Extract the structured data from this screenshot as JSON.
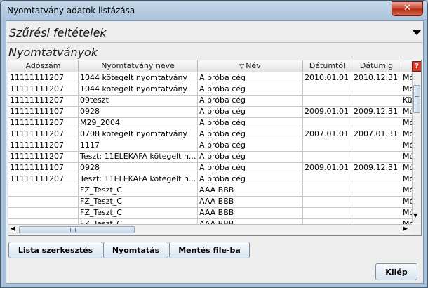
{
  "window": {
    "title": "Nyomtatvány adatok listázása",
    "close_glyph": "✕"
  },
  "filter": {
    "title": "Szűrési feltételek"
  },
  "section": {
    "title": "Nyomtatványok"
  },
  "table": {
    "columns": [
      "Adószám",
      "Nyomtatvány neve",
      "Név",
      "Dátumtól",
      "Dátumig",
      "?"
    ],
    "rows": [
      [
        "11111111207",
        "1044 kötegelt nyomtatvány",
        "A próba cég",
        "2010.01.01",
        "2010.12.31",
        "Mó"
      ],
      [
        "11111111207",
        "1044 kötegelt nyomtatvány",
        "A próba cég",
        "",
        "",
        "Mó"
      ],
      [
        "11111111207",
        "09teszt",
        "A próba cég",
        "",
        "",
        "Kü"
      ],
      [
        "11111111107",
        "0928",
        "A próba cég",
        "2009.01.01",
        "2009.12.31",
        "Mó"
      ],
      [
        "11111111207",
        "M29_2004",
        "A próba cég",
        "",
        "",
        "Mó"
      ],
      [
        "11111111207",
        "0708 kötegelt nyomtatvány",
        "A próba cég",
        "2007.01.01",
        "2007.01.31",
        "Mó"
      ],
      [
        "11111111207",
        "1117",
        "A próba cég",
        "",
        "",
        "Mó"
      ],
      [
        "11111111207",
        "Teszt: 11ELEKAFA kötegelt n...",
        "A próba cég",
        "",
        "",
        "Mó"
      ],
      [
        "11111111107",
        "0928",
        "A próba cég",
        "2009.01.01",
        "2009.12.31",
        "Mó"
      ],
      [
        "11111111207",
        "Teszt: 11ELEKAFA kötegelt n...",
        "A próba cég",
        "",
        "",
        "Mó"
      ],
      [
        "",
        "FZ_Teszt_C",
        "AAA BBB",
        "",
        "",
        "Mó"
      ],
      [
        "",
        "FZ_Teszt_C",
        "AAA BBB",
        "",
        "",
        "Mó"
      ],
      [
        "",
        "FZ_Teszt_C",
        "AAA BBB",
        "",
        "",
        "Mó"
      ],
      [
        "",
        "FZ_Teszt_C",
        "AAA BBB",
        "",
        "",
        "Mó"
      ]
    ]
  },
  "buttons": {
    "edit_list": "Lista szerkesztés",
    "print": "Nyomtatás",
    "save_file": "Mentés file-ba",
    "exit": "Kilép"
  }
}
